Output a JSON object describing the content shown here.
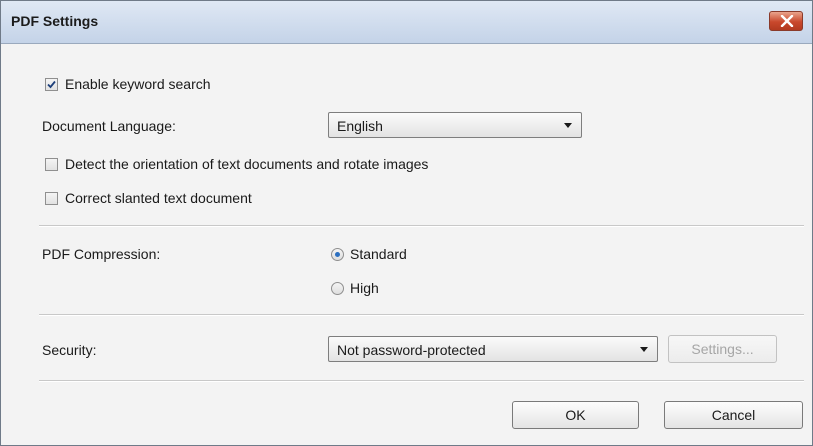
{
  "window": {
    "title": "PDF Settings"
  },
  "options": {
    "keyword_search_label": "Enable keyword search",
    "keyword_search_checked": true,
    "document_language_label": "Document Language:",
    "document_language_value": "English",
    "detect_orientation_label": "Detect the orientation of text documents and rotate images",
    "detect_orientation_checked": false,
    "correct_slanted_label": "Correct slanted text document",
    "correct_slanted_checked": false
  },
  "compression": {
    "label": "PDF Compression:",
    "standard_label": "Standard",
    "high_label": "High",
    "selected": "Standard"
  },
  "security": {
    "label": "Security:",
    "value": "Not password-protected",
    "settings_button": "Settings..."
  },
  "footer": {
    "ok_label": "OK",
    "cancel_label": "Cancel"
  },
  "icons": {
    "close": "close-icon",
    "check": "check-icon",
    "dropdown": "chevron-down-icon"
  },
  "colors": {
    "titlebar": "#c4d3e8",
    "close_button": "#c9482c",
    "radio_selected": "#2b6fc0"
  }
}
